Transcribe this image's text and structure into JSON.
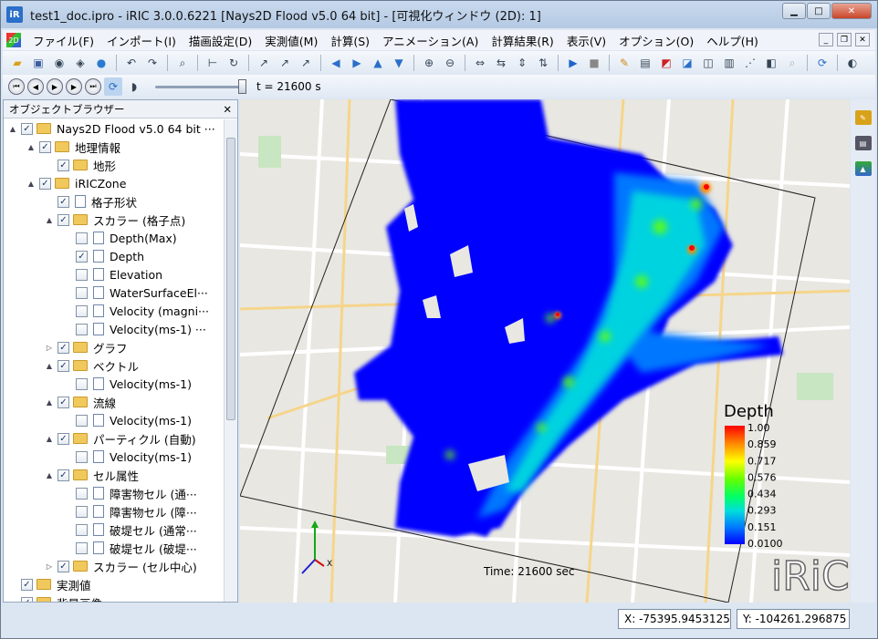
{
  "window": {
    "title": "test1_doc.ipro - iRIC 3.0.0.6221 [Nays2D Flood v5.0 64 bit] - [可視化ウィンドウ (2D): 1]",
    "app_icon": "iR"
  },
  "menu": {
    "items": [
      "ファイル(F)",
      "インポート(I)",
      "描画設定(D)",
      "実測値(M)",
      "計算(S)",
      "アニメーション(A)",
      "計算結果(R)",
      "表示(V)",
      "オプション(O)",
      "ヘルプ(H)"
    ]
  },
  "animation": {
    "time_label": "t = 21600 s",
    "slider_fraction": 1.0
  },
  "object_browser": {
    "title": "オブジェクトブラウザー",
    "close": "✕",
    "items": [
      {
        "label": "Nays2D Flood v5.0 64 bit ···",
        "checked": true,
        "type": "folder",
        "level": 0,
        "expander": "▲"
      },
      {
        "label": "地理情報",
        "checked": true,
        "type": "folder",
        "level": 1,
        "expander": "▲"
      },
      {
        "label": "地形",
        "checked": true,
        "type": "folder",
        "level": 2,
        "expander": ""
      },
      {
        "label": "iRICZone",
        "checked": true,
        "type": "folder",
        "level": 1,
        "expander": "▲"
      },
      {
        "label": "格子形状",
        "checked": true,
        "type": "file",
        "level": 2,
        "expander": ""
      },
      {
        "label": "スカラー (格子点)",
        "checked": true,
        "type": "folder",
        "level": 2,
        "expander": "▲"
      },
      {
        "label": "Depth(Max)",
        "checked": false,
        "type": "file",
        "level": 3,
        "expander": ""
      },
      {
        "label": "Depth",
        "checked": true,
        "type": "file",
        "level": 3,
        "expander": ""
      },
      {
        "label": "Elevation",
        "checked": false,
        "type": "file",
        "level": 3,
        "expander": ""
      },
      {
        "label": "WaterSurfaceEl···",
        "checked": false,
        "type": "file",
        "level": 3,
        "expander": ""
      },
      {
        "label": "Velocity (magni···",
        "checked": false,
        "type": "file",
        "level": 3,
        "expander": ""
      },
      {
        "label": "Velocity(ms-1) ···",
        "checked": false,
        "type": "file",
        "level": 3,
        "expander": ""
      },
      {
        "label": "グラフ",
        "checked": true,
        "type": "folder",
        "level": 2,
        "expander": "▷"
      },
      {
        "label": "ベクトル",
        "checked": true,
        "type": "folder",
        "level": 2,
        "expander": "▲"
      },
      {
        "label": "Velocity(ms-1)",
        "checked": false,
        "type": "file",
        "level": 3,
        "expander": ""
      },
      {
        "label": "流線",
        "checked": true,
        "type": "folder",
        "level": 2,
        "expander": "▲"
      },
      {
        "label": "Velocity(ms-1)",
        "checked": false,
        "type": "file",
        "level": 3,
        "expander": ""
      },
      {
        "label": "パーティクル (自動)",
        "checked": true,
        "type": "folder",
        "level": 2,
        "expander": "▲"
      },
      {
        "label": "Velocity(ms-1)",
        "checked": false,
        "type": "file",
        "level": 3,
        "expander": ""
      },
      {
        "label": "セル属性",
        "checked": true,
        "type": "folder",
        "level": 2,
        "expander": "▲"
      },
      {
        "label": "障害物セル (通···",
        "checked": false,
        "type": "file",
        "level": 3,
        "expander": ""
      },
      {
        "label": "障害物セル (障···",
        "checked": false,
        "type": "file",
        "level": 3,
        "expander": ""
      },
      {
        "label": "破堤セル (通常···",
        "checked": false,
        "type": "file",
        "level": 3,
        "expander": ""
      },
      {
        "label": "破堤セル (破堤···",
        "checked": false,
        "type": "file",
        "level": 3,
        "expander": ""
      },
      {
        "label": "スカラー (セル中心)",
        "checked": true,
        "type": "folder",
        "level": 2,
        "expander": "▷"
      },
      {
        "label": "実測値",
        "checked": true,
        "type": "folder",
        "level": 0,
        "expander": ""
      },
      {
        "label": "背景画像",
        "checked": true,
        "type": "folder",
        "level": 0,
        "expander": ""
      }
    ]
  },
  "view": {
    "time_text": "Time: 21600 sec",
    "logo_text": "iRiC",
    "axis_x": "X",
    "colorbar": {
      "title": "Depth",
      "labels": [
        "1.00",
        "0.859",
        "0.717",
        "0.576",
        "0.434",
        "0.293",
        "0.151",
        "0.0100"
      ],
      "colors": [
        "#ff0000",
        "#ff8800",
        "#ffff00",
        "#66ff00",
        "#00ff66",
        "#00dddd",
        "#0077ff",
        "#0000ff"
      ]
    }
  },
  "status": {
    "x": "X: -75395.9453125",
    "y": "Y: -104261.296875"
  }
}
